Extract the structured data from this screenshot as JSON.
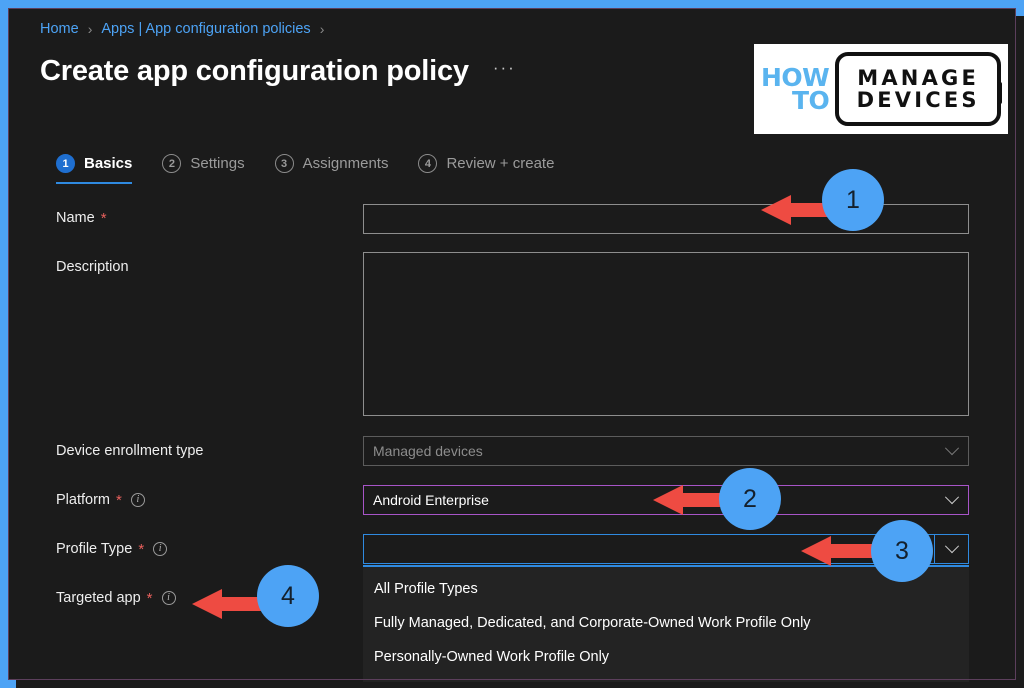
{
  "window": {
    "frame_color": "#4da3f5",
    "background": "#1b1b1b"
  },
  "breadcrumb": {
    "items": [
      {
        "label": "Home"
      },
      {
        "label": "Apps | App configuration policies"
      }
    ],
    "separator": "›"
  },
  "header": {
    "title": "Create app configuration policy",
    "more_menu": "···"
  },
  "logo": {
    "line1": "HOW",
    "line2": "TO",
    "word1": "MANAGE",
    "word2": "DEVICES",
    "accent_color": "#5ab4ef"
  },
  "tabs": [
    {
      "num": "1",
      "label": "Basics",
      "active": true
    },
    {
      "num": "2",
      "label": "Settings",
      "active": false
    },
    {
      "num": "3",
      "label": "Assignments",
      "active": false
    },
    {
      "num": "4",
      "label": "Review + create",
      "active": false
    }
  ],
  "form": {
    "name": {
      "label": "Name",
      "required": "*",
      "value": "",
      "placeholder": ""
    },
    "description": {
      "label": "Description",
      "value": "",
      "placeholder": ""
    },
    "device_enrollment_type": {
      "label": "Device enrollment type",
      "value": "Managed devices",
      "disabled": true
    },
    "platform": {
      "label": "Platform",
      "required": "*",
      "info": "i",
      "value": "Android Enterprise",
      "highlight_color": "#a855c8"
    },
    "profile_type": {
      "label": "Profile Type",
      "required": "*",
      "info": "i",
      "value": "",
      "highlight_color": "#2f8ae0"
    },
    "targeted_app": {
      "label": "Targeted app",
      "required": "*",
      "info": "i"
    }
  },
  "dropdown": {
    "open": true,
    "options": [
      {
        "label": "All Profile Types"
      },
      {
        "label": "Fully Managed, Dedicated, and Corporate-Owned Work Profile Only"
      },
      {
        "label": "Personally-Owned Work Profile Only"
      }
    ]
  },
  "annotations": [
    {
      "number": "1"
    },
    {
      "number": "2"
    },
    {
      "number": "3"
    },
    {
      "number": "4"
    }
  ]
}
